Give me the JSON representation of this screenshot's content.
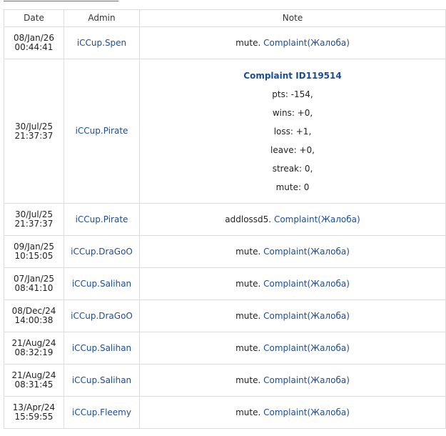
{
  "table": {
    "headers": {
      "date": "Date",
      "admin": "Admin",
      "note": "Note"
    },
    "rows": [
      {
        "date": "08/Jan/26\n00:44:41",
        "admin": "iCCup.Spen",
        "note_prefix": "mute. ",
        "complaint": "Complaint(Жалоба)"
      },
      {
        "date": "30/Jul/25\n21:37:37",
        "admin": "iCCup.Pirate",
        "note_title": "Complaint ID119514",
        "note_lines": [
          "pts: -154,",
          "wins: +0,",
          "loss: +1,",
          "leave: +0,",
          "streak: 0,",
          "mute: 0"
        ]
      },
      {
        "date": "30/Jul/25\n21:37:37",
        "admin": "iCCup.Pirate",
        "note_prefix": "addlossd5. ",
        "complaint": "Complaint(Жалоба)"
      },
      {
        "date": "09/Jan/25\n10:15:05",
        "admin": "iCCup.DraGoO",
        "note_prefix": "mute. ",
        "complaint": "Complaint(Жалоба)"
      },
      {
        "date": "07/Jan/25\n08:41:10",
        "admin": "iCCup.Salihan",
        "note_prefix": "mute. ",
        "complaint": "Complaint(Жалоба)"
      },
      {
        "date": "08/Dec/24\n14:00:38",
        "admin": "iCCup.DraGoO",
        "note_prefix": "mute. ",
        "complaint": "Complaint(Жалоба)"
      },
      {
        "date": "21/Aug/24\n08:32:19",
        "admin": "iCCup.Salihan",
        "note_prefix": "mute. ",
        "complaint": "Complaint(Жалоба)"
      },
      {
        "date": "21/Aug/24\n08:31:45",
        "admin": "iCCup.Salihan",
        "note_prefix": "mute. ",
        "complaint": "Complaint(Жалоба)"
      },
      {
        "date": "13/Apr/24\n15:59:55",
        "admin": "iCCup.Fleemy",
        "note_prefix": "mute. ",
        "complaint": "Complaint(Жалоба)"
      }
    ]
  },
  "colors": {
    "link": "#1a4c9c",
    "border": "#dcdcdc",
    "text": "#222222"
  }
}
